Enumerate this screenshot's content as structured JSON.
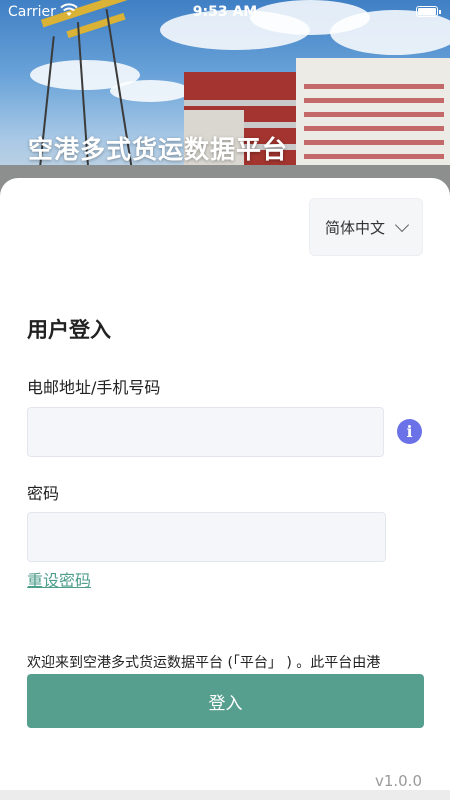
{
  "status_bar": {
    "carrier": "Carrier",
    "time": "9:53 AM"
  },
  "header": {
    "title": "空港多式货运数据平台"
  },
  "language_select": {
    "selected": "简体中文"
  },
  "login": {
    "title": "用户登入",
    "email_label": "电邮地址/手机号码",
    "email_value": "",
    "email_placeholder": "",
    "password_label": "密码",
    "password_value": "",
    "password_placeholder": "",
    "reset_link": "重设密码",
    "welcome_text": "欢迎来到空港多式货运数据平台 (「平台」 ) 。此平台由港",
    "submit_label": "登入"
  },
  "info_icon": "information-icon",
  "version": "v1.0.0",
  "colors": {
    "accent": "#569f8e",
    "link": "#4e9e8c",
    "info": "#6b72e8"
  }
}
